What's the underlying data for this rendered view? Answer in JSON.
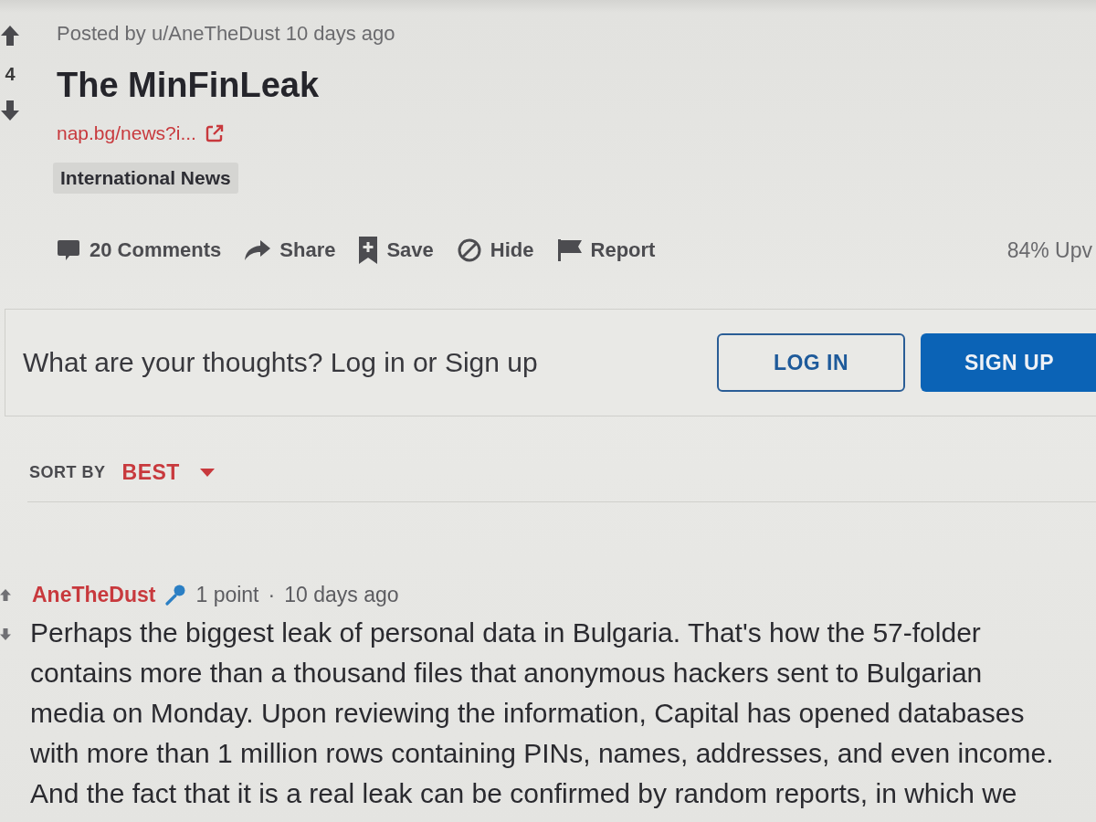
{
  "post": {
    "score": "4",
    "meta": "Posted by u/AneTheDust 10 days ago",
    "title": "The MinFinLeak",
    "link": "nap.bg/news?i...",
    "flair": "International News",
    "actions": [
      {
        "kind": "comments",
        "label": "20 Comments"
      },
      {
        "kind": "share",
        "label": "Share"
      },
      {
        "kind": "save",
        "label": "Save"
      },
      {
        "kind": "hide",
        "label": "Hide"
      },
      {
        "kind": "report",
        "label": "Report"
      }
    ],
    "upvote_ratio": "84% Upv"
  },
  "comment_prompt": {
    "text": "What are your thoughts? Log in or Sign up",
    "buttons": [
      {
        "kind": "outline",
        "label": "LOG IN"
      },
      {
        "kind": "filled",
        "label": "SIGN UP"
      }
    ]
  },
  "sort": {
    "label": "SORT BY",
    "value": "BEST"
  },
  "comments": [
    {
      "author": "AneTheDust",
      "points": "1 point",
      "separator": "·",
      "time": "10 days ago",
      "body": "Perhaps the biggest leak of personal data in Bulgaria. That's how the 57-folder contains more than a thousand files that anonymous hackers sent to Bulgarian media on Monday. Upon reviewing the information, Capital has opened databases with more than 1 million rows containing PINs, names, addresses, and even income. And the fact that it is a real leak can be confirmed by random reports, in which we"
    }
  ]
}
